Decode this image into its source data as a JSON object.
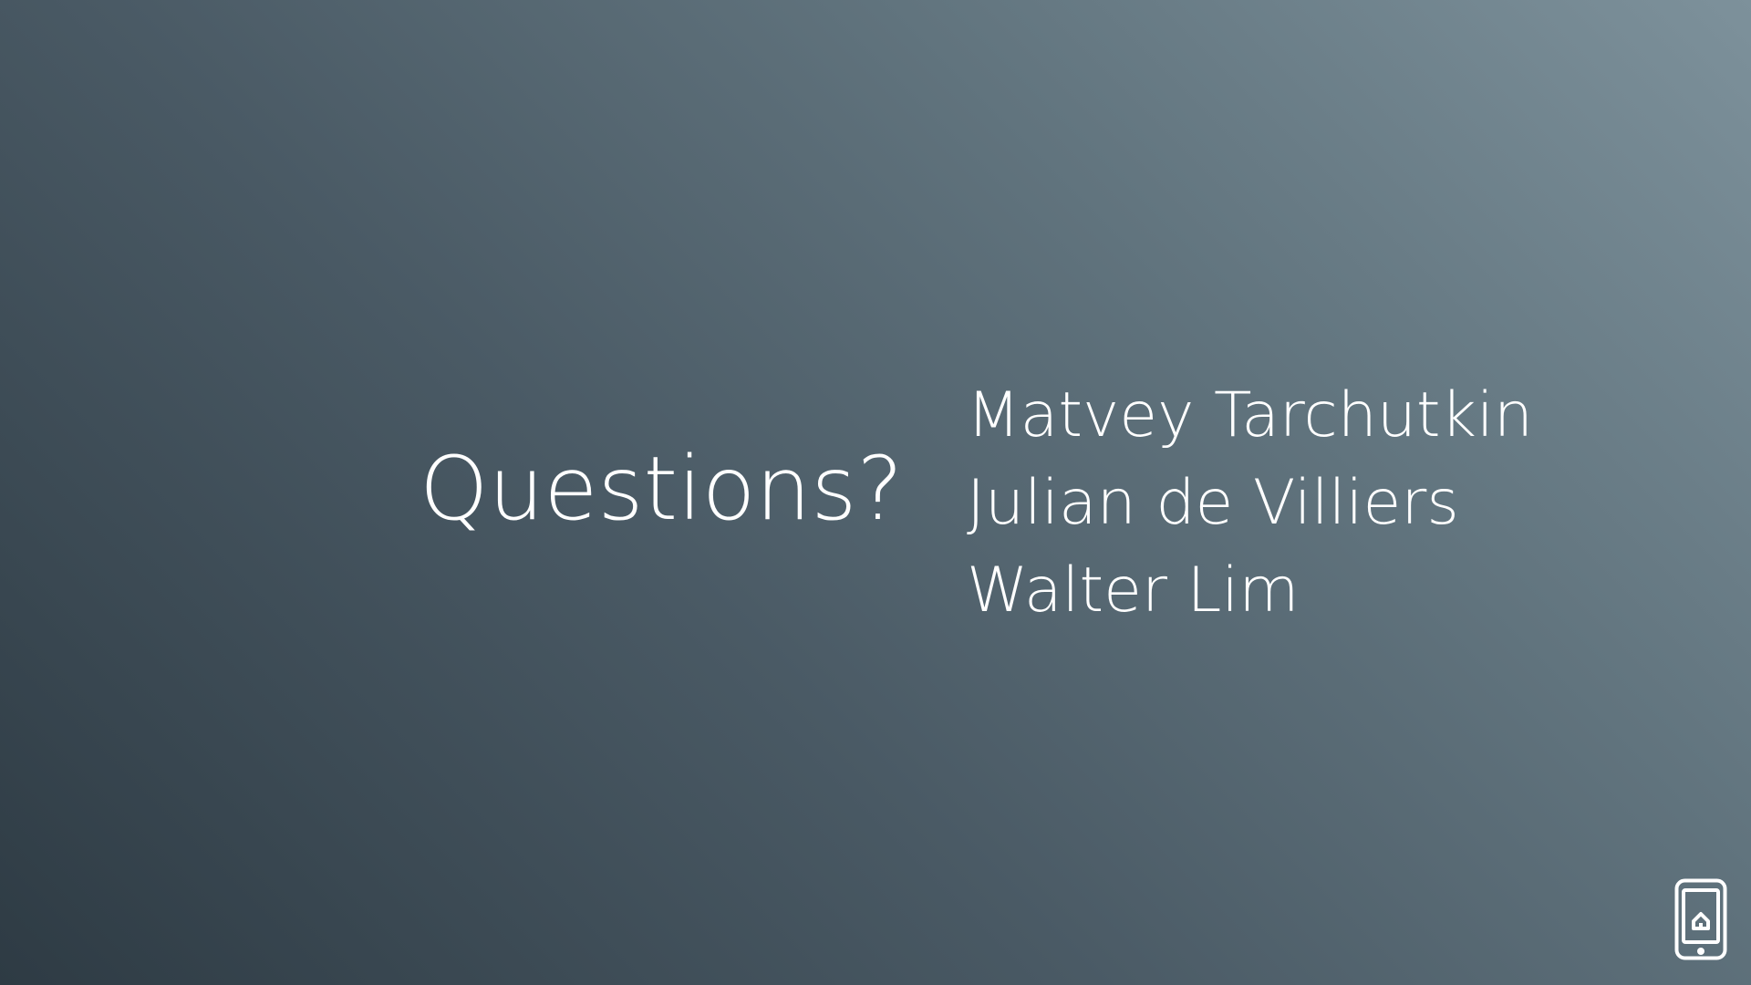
{
  "slide": {
    "heading": "Questions?",
    "presenters": [
      "Matvey Tarchutkin",
      "Julian de Villiers",
      "Walter Lim"
    ],
    "icons": {
      "corner": "phone-home-icon"
    },
    "colors": {
      "text": "#ffffff",
      "gradient_dark": "#2e3b44",
      "gradient_light": "#7d919b"
    }
  }
}
